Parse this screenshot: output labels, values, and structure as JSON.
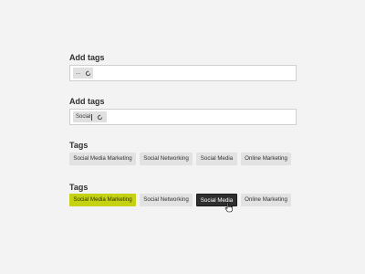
{
  "section1": {
    "heading": "Add tags",
    "chip_text": "..."
  },
  "section2": {
    "heading": "Add tags",
    "chip_text": "Social"
  },
  "section3": {
    "heading": "Tags",
    "tags": [
      "Social Media Marketing",
      "Social Networking",
      "Social Media",
      "Online Marketing"
    ]
  },
  "section4": {
    "heading": "Tags",
    "tags": [
      "Social Media Marketing",
      "Social Networking",
      "Social Media",
      "Online Marketing"
    ],
    "selected_tag": "Social Media Marketing",
    "hovered_tag": "Social Media"
  },
  "colors": {
    "background": "#f3f3f3",
    "tag_bg": "#e2e2e2",
    "selected_tag_bg": "#c5d213",
    "hovered_tag_bg": "#2e2e2e"
  },
  "icons": {
    "chip_action": "refresh-icon",
    "cursor": "hand-pointer-icon"
  }
}
